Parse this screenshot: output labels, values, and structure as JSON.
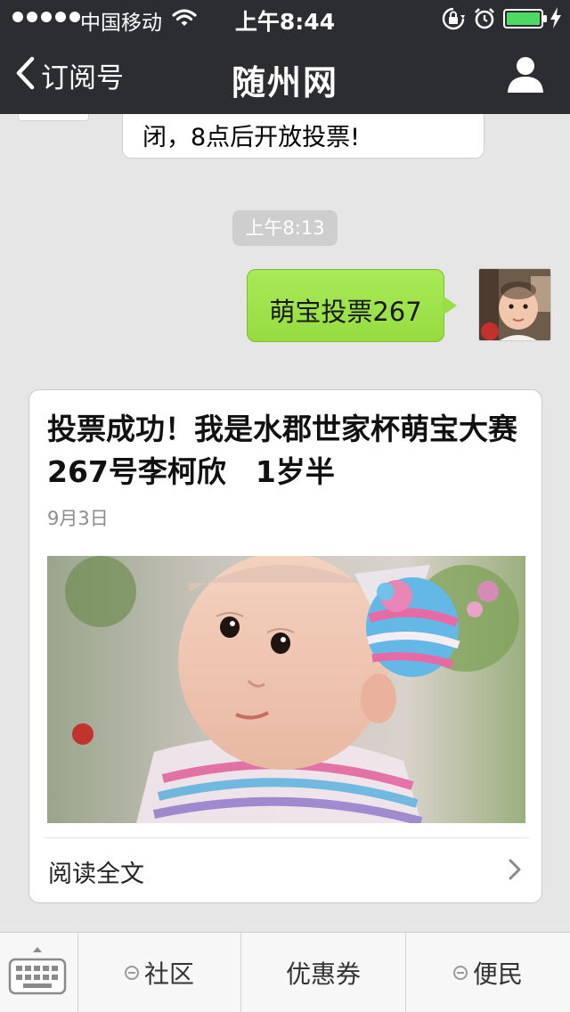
{
  "status_bar": {
    "carrier": "中国移动",
    "time": "上午8:44",
    "icons": [
      "signal-dots-icon",
      "wifi-icon",
      "rotation-lock-icon",
      "alarm-icon",
      "battery-icon",
      "charging-icon"
    ]
  },
  "nav": {
    "back_label": "订阅号",
    "title": "随州网",
    "back_icon": "chevron-left-icon",
    "profile_icon": "person-icon"
  },
  "chat": {
    "previous_message_tail": "闭，8点后开放投票!",
    "timestamp": "上午8:13",
    "sent_message": "萌宝投票267",
    "card": {
      "title": "投票成功！我是水郡世家杯萌宝大赛267号李柯欣　1岁半",
      "date": "9月3日",
      "read_more": "阅读全文"
    }
  },
  "bottom_menu": {
    "keyboard_icon": "keyboard-icon",
    "items": [
      {
        "label": "社区",
        "icon": "minus-circle-icon"
      },
      {
        "label": "优惠券"
      },
      {
        "label": "便民",
        "icon": "minus-circle-icon"
      }
    ]
  },
  "colors": {
    "nav_bg": "#2b2d31",
    "chat_bg": "#e6e6e6",
    "sent_bubble": "#9fe24b",
    "time_pill": "#cecece"
  }
}
